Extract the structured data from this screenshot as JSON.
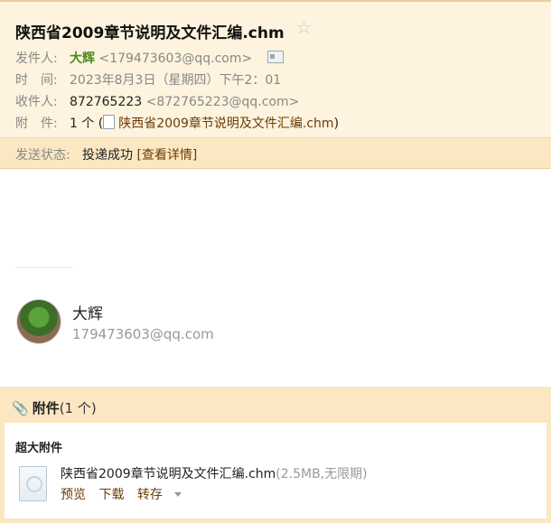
{
  "header": {
    "subject": "陕西省2009章节说明及文件汇编.chm",
    "star_glyph": "☆",
    "from_label": "发件人:",
    "from_name": "大辉",
    "from_email": "<179473603@qq.com>",
    "time_label": "时　间:",
    "time_value": "2023年8月3日（星期四）下午2：01",
    "to_label": "收件人:",
    "to_name": "872765223",
    "to_email": "<872765223@qq.com>",
    "attach_label": "附　件:",
    "attach_count": "1 个 (",
    "attach_file": "陕西省2009章节说明及文件汇编.chm",
    "attach_close": ")"
  },
  "status": {
    "label": "发送状态:",
    "value": "投递成功",
    "detail_link": "[查看详情]"
  },
  "signature": {
    "name": "大辉",
    "email": "179473603@qq.com"
  },
  "attachments": {
    "clip_glyph": "📎",
    "title": "附件",
    "count": "(1 个)",
    "section": "超大附件",
    "file_name": "陕西省2009章节说明及文件汇编.chm",
    "file_meta": "(2.5MB,无限期)",
    "preview": "预览",
    "download": "下载",
    "forward": "转存"
  }
}
